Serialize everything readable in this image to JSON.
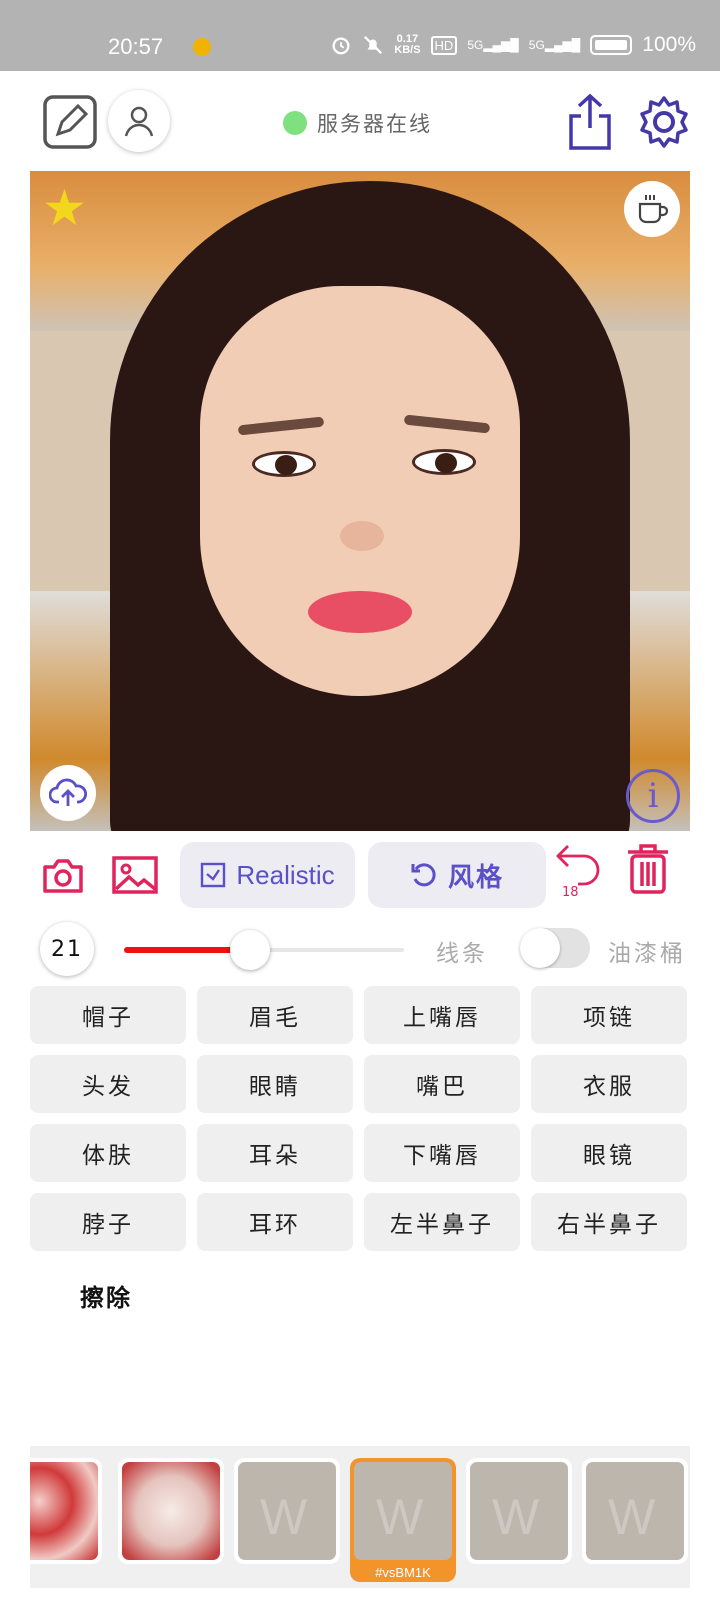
{
  "status_bar": {
    "time": "20:57",
    "speed_value": "0.17",
    "speed_unit": "KB/S",
    "hd": "HD",
    "net1": "5G",
    "net2": "5G",
    "battery": "100%"
  },
  "toolbar": {
    "server_status": "服务器在线",
    "server_status_color": "#7ee07e",
    "icons": [
      "edit-icon",
      "user-icon",
      "share-icon",
      "gear-icon"
    ]
  },
  "photo": {
    "info_glyph": "i"
  },
  "actions": {
    "mode_label": "Realistic",
    "style_label": "风格",
    "undo_count": "18"
  },
  "brush": {
    "size_value": "21",
    "size_fraction": 0.45,
    "lines_label": "线条",
    "bucket_label": "油漆桶",
    "bucket_on": false
  },
  "parts": [
    [
      "帽子",
      "眉毛",
      "上嘴唇",
      "项链"
    ],
    [
      "头发",
      "眼睛",
      "嘴巴",
      "衣服"
    ],
    [
      "体肤",
      "耳朵",
      "下嘴唇",
      "眼镜"
    ],
    [
      "脖子",
      "耳环",
      "左半鼻子",
      "右半鼻子"
    ]
  ],
  "erase_label": "擦除",
  "styles_strip": {
    "selected_tag": "#vsBM1K"
  },
  "colors": {
    "accent_purple": "#5a50c8",
    "accent_red": "#e0245e",
    "slider_red": "#ee1111",
    "selected_orange": "#f2942a"
  }
}
